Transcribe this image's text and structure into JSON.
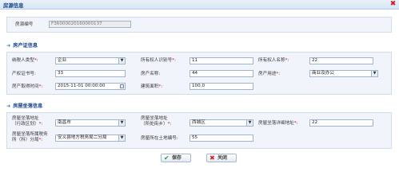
{
  "window": {
    "title": "房源信息"
  },
  "listing": {
    "label": "房源编号",
    "value": "F36000020160000137"
  },
  "cert_section": {
    "title": "房产证信息",
    "taxpayer_type": {
      "label": "纳税人类型",
      "value": "企业"
    },
    "owner_id": {
      "label": "所有权人识别号",
      "value": "11"
    },
    "owner_name": {
      "label": "所有权人名称",
      "value": "22"
    },
    "cert_no": {
      "label": "产权证书号",
      "value": "33"
    },
    "property_name": {
      "label": "房产名称",
      "value": "44"
    },
    "property_use": {
      "label": "房产用途",
      "value": "商业及办公"
    },
    "acquired_time": {
      "label": "房产取得时间",
      "value": "2015-11-01 00:00:00"
    },
    "floor_area": {
      "label": "建筑面积",
      "value": "100.0"
    }
  },
  "location_section": {
    "title": "房屋坐落信息",
    "admin_region": {
      "label_line1": "房屋坐落地址",
      "label_line2": "（行政区划）",
      "value": "南昌市"
    },
    "street": {
      "label_line1": "房屋坐落地址",
      "label_line2": "（所处街乡）",
      "value": "西城区"
    },
    "detail_address": {
      "label": "房屋坐落详细地址",
      "value": "22"
    },
    "tax_office": {
      "label_line1": "房屋坐落所属税务",
      "label_line2": "所（科）分局",
      "value": "安义县地方税务局二分局"
    },
    "land_no": {
      "label": "房屋所在土地编号",
      "value": "55"
    }
  },
  "buttons": {
    "save": "保存",
    "close": "关闭"
  }
}
